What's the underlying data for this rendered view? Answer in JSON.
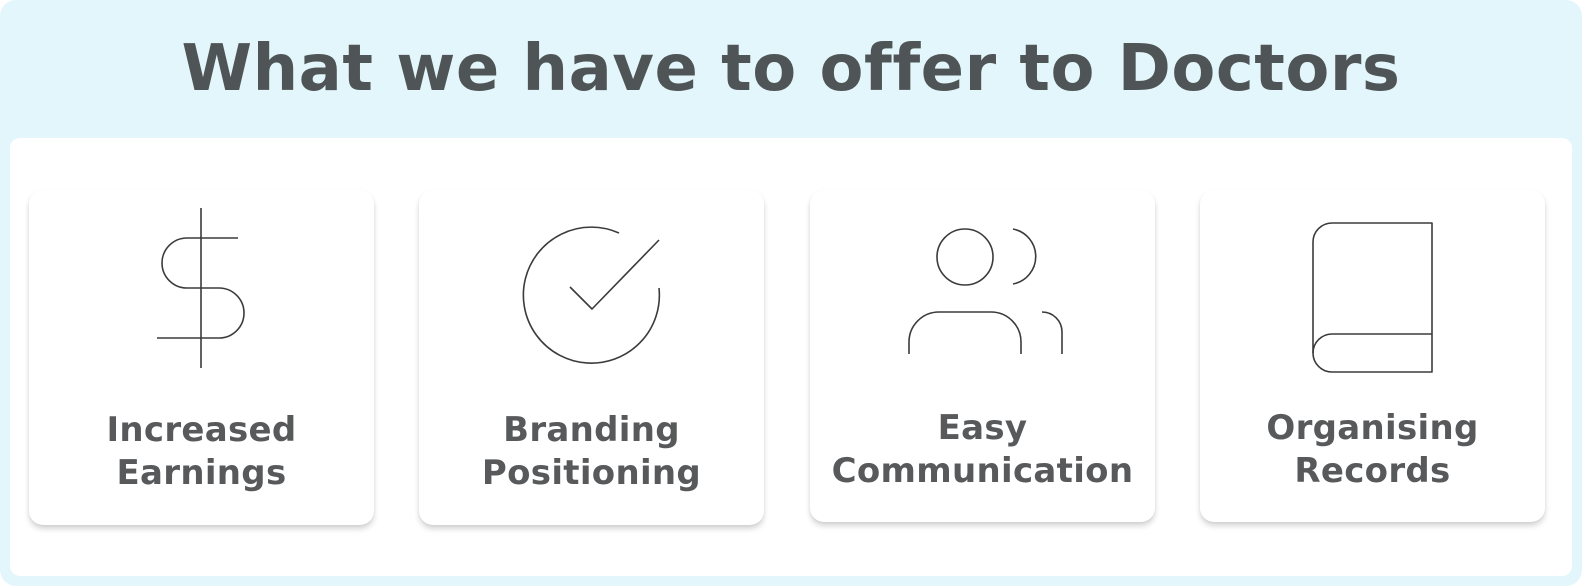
{
  "header": {
    "title": "What we have to offer to Doctors"
  },
  "cards": [
    {
      "icon": "dollar-icon",
      "label_line1": "Increased",
      "label_line2": "Earnings"
    },
    {
      "icon": "check-circle-icon",
      "label_line1": "Branding",
      "label_line2": "Positioning"
    },
    {
      "icon": "users-icon",
      "label_line1": "Easy",
      "label_line2": "Communication"
    },
    {
      "icon": "book-icon",
      "label_line1": "Organising",
      "label_line2": "Records"
    }
  ],
  "colors": {
    "background": "#e3f6fb",
    "title": "#4f5556",
    "label": "#58595b",
    "icon_stroke": "#3b3b3b"
  }
}
